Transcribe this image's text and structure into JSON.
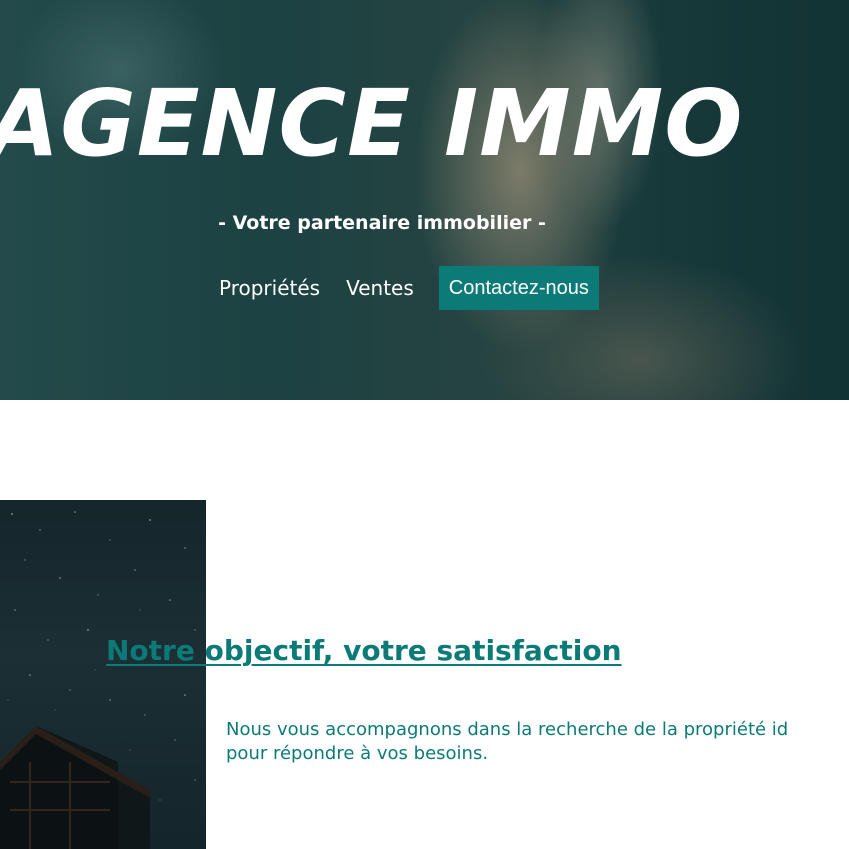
{
  "hero": {
    "title": "AGENCE IMMO",
    "subtitle": "- Votre partenaire immobilier -",
    "nav": {
      "properties_label": "Propriétés",
      "sales_label": "Ventes",
      "contact_label": "Contactez-nous"
    }
  },
  "about": {
    "heading": "Notre objectif, votre satisfaction",
    "text_line1": "Nous vous accompagnons dans la recherche de la propriété id",
    "text_line2": "pour répondre à vos besoins."
  },
  "colors": {
    "accent": "#0c7b78",
    "hero_overlay": "#1f4a4b",
    "text_light": "#ffffff"
  },
  "icons": {
    "hero_background": "blurred-interior-photo",
    "about_image": "night-sky-cabin-photo"
  }
}
